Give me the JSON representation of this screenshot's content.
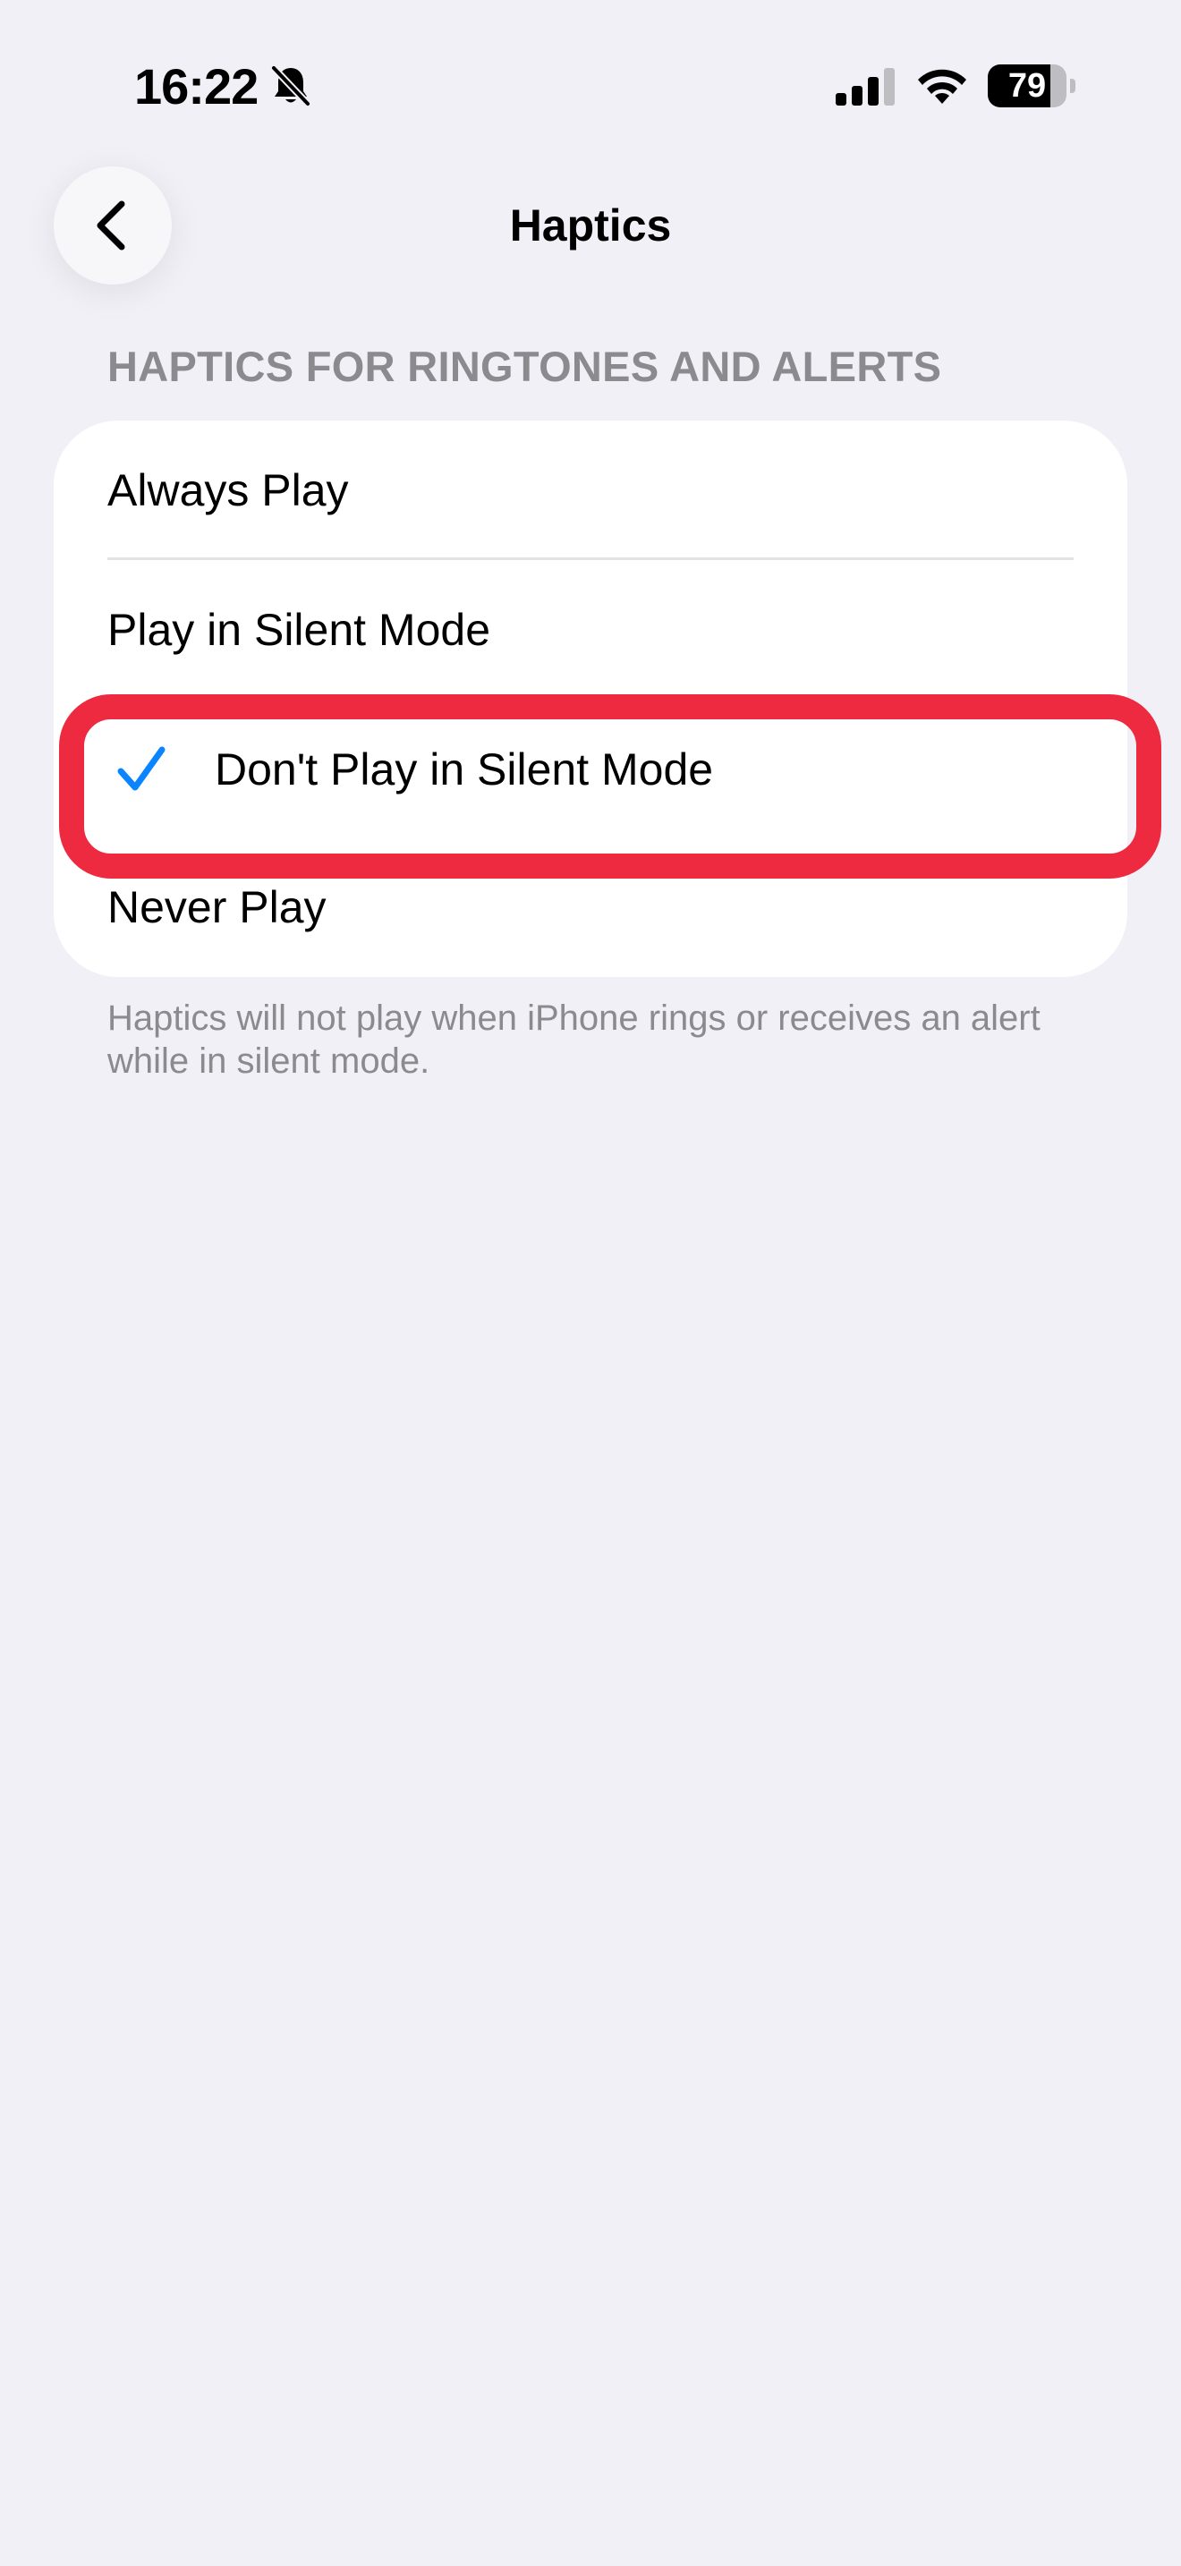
{
  "status_bar": {
    "time": "16:22",
    "battery_level": "79",
    "battery_fraction": 0.79,
    "icons": [
      "bell-slash-icon",
      "cellular-signal-icon",
      "wifi-icon",
      "battery-icon"
    ]
  },
  "nav": {
    "title": "Haptics",
    "back_icon": "chevron-left-icon"
  },
  "section": {
    "header": "HAPTICS FOR RINGTONES AND ALERTS",
    "options": [
      {
        "label": "Always Play",
        "selected": false
      },
      {
        "label": "Play in Silent Mode",
        "selected": false
      },
      {
        "label": "Don't Play in Silent Mode",
        "selected": true
      },
      {
        "label": "Never Play",
        "selected": false
      }
    ],
    "footer": "Haptics will not play when iPhone rings or receives an alert while in silent mode."
  },
  "colors": {
    "background": "#f1f0f6",
    "card": "#ffffff",
    "accent_blue": "#0a84ff",
    "highlight_red": "#ee2a41",
    "secondary_text": "#8a8a8f"
  }
}
